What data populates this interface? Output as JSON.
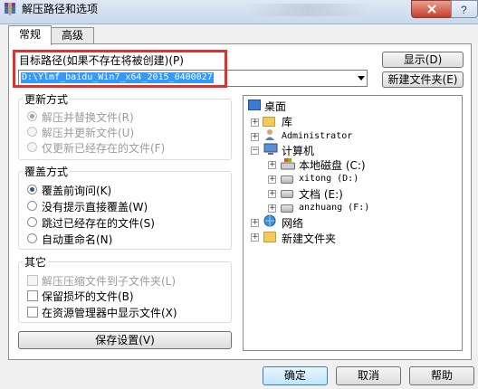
{
  "window": {
    "title": "解压路径和选项"
  },
  "tabs": [
    {
      "label": "常规"
    },
    {
      "label": "高级"
    }
  ],
  "target": {
    "label": "目标路径(如果不存在将被创建)(P)",
    "value": "D:\\Ylmf_baidu_Win7_x64_2015_0400027",
    "show_button": "显示(D)",
    "new_folder_button": "新建文件夹(E)"
  },
  "update_mode": {
    "title": "更新方式",
    "options": [
      {
        "label": "解压并替换文件(R)",
        "checked": true
      },
      {
        "label": "解压并更新文件(U)",
        "checked": false
      },
      {
        "label": "仅更新已经存在的文件(F)",
        "checked": false
      }
    ]
  },
  "overwrite_mode": {
    "title": "覆盖方式",
    "options": [
      {
        "label": "覆盖前询问(K)",
        "checked": true
      },
      {
        "label": "没有提示直接覆盖(W)",
        "checked": false
      },
      {
        "label": "跳过已经存在的文件(S)",
        "checked": false
      },
      {
        "label": "自动重命名(N)",
        "checked": false
      }
    ]
  },
  "misc": {
    "title": "其它",
    "options": [
      {
        "label": "解压压缩文件到子文件夹(L)",
        "checked": false,
        "disabled": true
      },
      {
        "label": "保留损坏的文件(B)",
        "checked": false,
        "disabled": false
      },
      {
        "label": "在资源管理器中显示文件(X)",
        "checked": false,
        "disabled": false
      }
    ]
  },
  "save_settings_button": "保存设置(V)",
  "tree": {
    "desktop": "桌面",
    "library": "库",
    "user": "Administrator",
    "computer": "计算机",
    "drive_c": "本地磁盘 (C:)",
    "drive_d": "xitong (D:)",
    "drive_e": "文档 (E:)",
    "drive_f": "anzhuang (F:)",
    "network": "网络",
    "new_folder": "新建文件夹"
  },
  "footer": {
    "ok": "确定",
    "cancel": "取消",
    "help": "帮助"
  },
  "colors": {
    "highlight_box": "#e03030",
    "selection": "#3399ff"
  }
}
